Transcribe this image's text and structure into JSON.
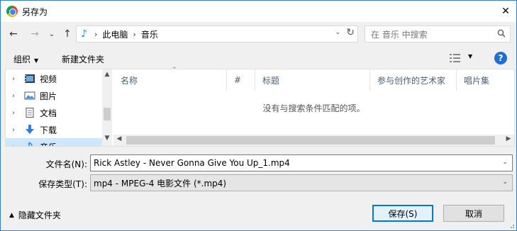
{
  "window": {
    "title": "另存为",
    "close_glyph": "✕"
  },
  "nav": {
    "back_glyph": "←",
    "forward_glyph": "→",
    "recent_glyph": "⌄",
    "up_glyph": "↑",
    "breadcrumb": [
      "此电脑",
      "音乐"
    ],
    "separator": "›",
    "refresh_glyph": "↻",
    "search_placeholder": "在 音乐 中搜索"
  },
  "toolbar": {
    "organize_label": "组织",
    "new_folder_label": "新建文件夹",
    "help_label": "?"
  },
  "tree": {
    "items": [
      {
        "label": "视频",
        "icon": "video-icon",
        "selected": false
      },
      {
        "label": "图片",
        "icon": "pictures-icon",
        "selected": false
      },
      {
        "label": "文档",
        "icon": "documents-icon",
        "selected": false
      },
      {
        "label": "下载",
        "icon": "downloads-icon",
        "selected": false
      },
      {
        "label": "音乐",
        "icon": "music-icon",
        "selected": true
      }
    ]
  },
  "filelist": {
    "columns": [
      "名称",
      "#",
      "标题",
      "参与创作的艺术家",
      "唱片集"
    ],
    "empty_message": "没有与搜索条件匹配的项。"
  },
  "save_form": {
    "filename_label": "文件名(N):",
    "filename_value": "Rick Astley - Never Gonna Give You Up_1.mp4",
    "type_label": "保存类型(T):",
    "type_value": "mp4 - MPEG-4 电影文件 (*.mp4)"
  },
  "footer": {
    "hide_folders_label": "隐藏文件夹",
    "save_label": "保存(S)",
    "cancel_label": "取消"
  },
  "colors": {
    "accent": "#0078d7",
    "selection": "#cce8ff",
    "header_text": "#4c607a"
  }
}
